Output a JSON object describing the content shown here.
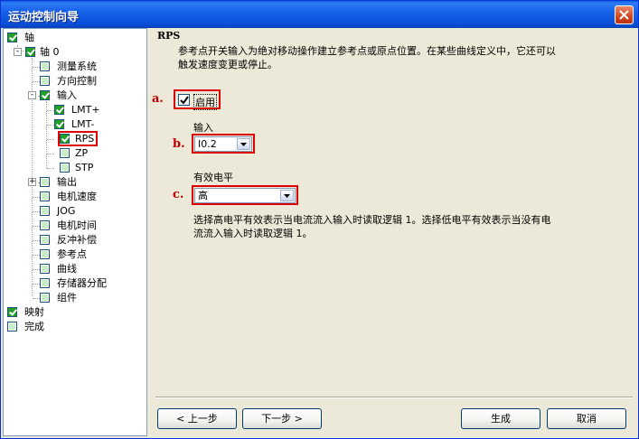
{
  "window": {
    "title": "运动控制向导"
  },
  "tree": {
    "nodes": [
      {
        "label": "轴"
      },
      {
        "label": "轴 0"
      },
      {
        "label": "测量系统"
      },
      {
        "label": "方向控制"
      },
      {
        "label": "输入"
      },
      {
        "label": "LMT+"
      },
      {
        "label": "LMT-"
      },
      {
        "label": "RPS"
      },
      {
        "label": "ZP"
      },
      {
        "label": "STP"
      },
      {
        "label": "输出"
      },
      {
        "label": "电机速度"
      },
      {
        "label": "JOG"
      },
      {
        "label": "电机时间"
      },
      {
        "label": "反冲补偿"
      },
      {
        "label": "参考点"
      },
      {
        "label": "曲线"
      },
      {
        "label": "存储器分配"
      },
      {
        "label": "组件"
      },
      {
        "label": "映射"
      },
      {
        "label": "完成"
      }
    ]
  },
  "content": {
    "title": "RPS",
    "description_line1": "参考点开关输入为绝对移动操作建立参考点或原点位置。在某些曲线定义中，它还可以",
    "description_line2": "触发速度变更或停止。",
    "mark_a": "a.",
    "mark_b": "b.",
    "mark_c": "c.",
    "enable_label": "启用",
    "input_label": "输入",
    "input_value": "I0.2",
    "level_label": "有效电平",
    "level_value": "高",
    "note_line1": "选择高电平有效表示当电流流入输入时读取逻辑 1。选择低电平有效表示当没有电",
    "note_line2": "流流入输入时读取逻辑 1。"
  },
  "buttons": {
    "prev": "< 上一步",
    "next": "下一步 >",
    "generate": "生成",
    "cancel": "取消"
  }
}
